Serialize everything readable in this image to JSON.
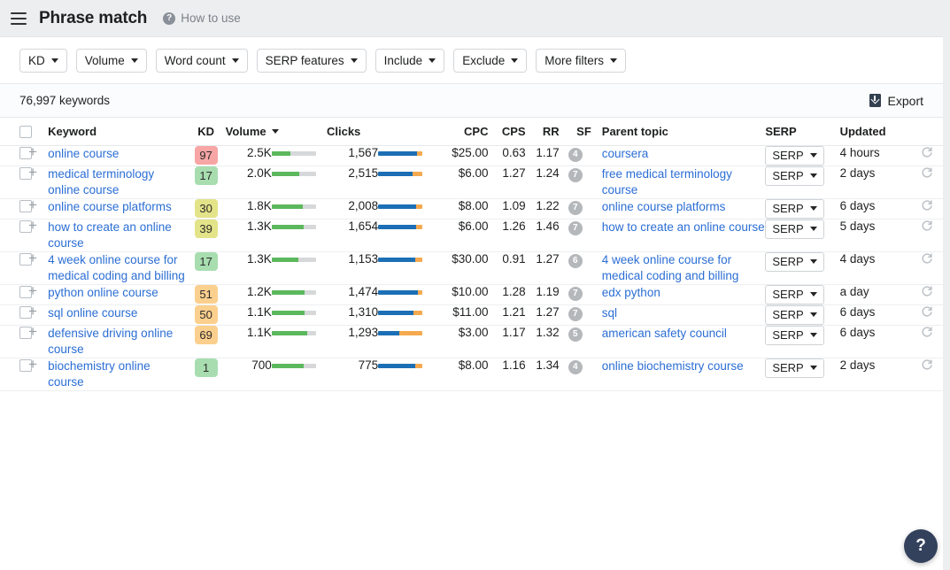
{
  "header": {
    "title": "Phrase match",
    "how_to_use": "How to use",
    "menu_icon": "hamburger-icon",
    "help_icon": "question-circle-icon"
  },
  "filters": [
    {
      "label": "KD"
    },
    {
      "label": "Volume"
    },
    {
      "label": "Word count"
    },
    {
      "label": "SERP features"
    },
    {
      "label": "Include"
    },
    {
      "label": "Exclude"
    },
    {
      "label": "More filters"
    }
  ],
  "summary": {
    "keyword_count": "76,997 keywords",
    "export_label": "Export",
    "export_icon": "download-icon"
  },
  "table": {
    "columns": [
      {
        "key": "checkbox",
        "label": ""
      },
      {
        "key": "add",
        "label": ""
      },
      {
        "key": "keyword",
        "label": "Keyword"
      },
      {
        "key": "kd",
        "label": "KD"
      },
      {
        "key": "volume",
        "label": "Volume",
        "sorted": true
      },
      {
        "key": "volume_bar",
        "label": ""
      },
      {
        "key": "clicks",
        "label": "Clicks"
      },
      {
        "key": "clicks_bar",
        "label": ""
      },
      {
        "key": "cpc",
        "label": "CPC"
      },
      {
        "key": "cps",
        "label": "CPS"
      },
      {
        "key": "rr",
        "label": "RR"
      },
      {
        "key": "sf",
        "label": "SF"
      },
      {
        "key": "parent_topic",
        "label": "Parent topic"
      },
      {
        "key": "serp",
        "label": "SERP"
      },
      {
        "key": "updated",
        "label": "Updated"
      }
    ],
    "serp_button_label": "SERP",
    "rows": [
      {
        "keyword": "online course",
        "kd": "97",
        "kd_color": "#f7a5a5",
        "volume": "2.5K",
        "volume_pct": 42,
        "clicks": "1,567",
        "clicks_blue_pct": 88,
        "clicks_orange_pct": 12,
        "cpc": "$25.00",
        "cps": "0.63",
        "rr": "1.17",
        "sf": "4",
        "parent_topic": "coursera",
        "serp": "SERP",
        "updated": "4 hours"
      },
      {
        "keyword": "medical terminology online course",
        "kd": "17",
        "kd_color": "#a8ddb0",
        "volume": "2.0K",
        "volume_pct": 62,
        "clicks": "2,515",
        "clicks_blue_pct": 78,
        "clicks_orange_pct": 22,
        "cpc": "$6.00",
        "cps": "1.27",
        "rr": "1.24",
        "sf": "7",
        "parent_topic": "free medical terminology course",
        "serp": "SERP",
        "updated": "2 days"
      },
      {
        "keyword": "online course platforms",
        "kd": "30",
        "kd_color": "#e3e389",
        "volume": "1.8K",
        "volume_pct": 70,
        "clicks": "2,008",
        "clicks_blue_pct": 86,
        "clicks_orange_pct": 14,
        "cpc": "$8.00",
        "cps": "1.09",
        "rr": "1.22",
        "sf": "7",
        "parent_topic": "online course platforms",
        "serp": "SERP",
        "updated": "6 days"
      },
      {
        "keyword": "how to create an online course",
        "kd": "39",
        "kd_color": "#e3e389",
        "volume": "1.3K",
        "volume_pct": 72,
        "clicks": "1,654",
        "clicks_blue_pct": 86,
        "clicks_orange_pct": 14,
        "cpc": "$6.00",
        "cps": "1.26",
        "rr": "1.46",
        "sf": "7",
        "parent_topic": "how to create an online course",
        "serp": "SERP",
        "updated": "5 days"
      },
      {
        "keyword": "4 week online course for medical coding and billing",
        "kd": "17",
        "kd_color": "#a8ddb0",
        "volume": "1.3K",
        "volume_pct": 60,
        "clicks": "1,153",
        "clicks_blue_pct": 84,
        "clicks_orange_pct": 16,
        "cpc": "$30.00",
        "cps": "0.91",
        "rr": "1.27",
        "sf": "6",
        "parent_topic": "4 week online course for medical coding and billing",
        "serp": "SERP",
        "updated": "4 days"
      },
      {
        "keyword": "python online course",
        "kd": "51",
        "kd_color": "#fbcf8d",
        "volume": "1.2K",
        "volume_pct": 74,
        "clicks": "1,474",
        "clicks_blue_pct": 90,
        "clicks_orange_pct": 10,
        "cpc": "$10.00",
        "cps": "1.28",
        "rr": "1.19",
        "sf": "7",
        "parent_topic": "edx python",
        "serp": "SERP",
        "updated": "a day"
      },
      {
        "keyword": "sql online course",
        "kd": "50",
        "kd_color": "#fbcf8d",
        "volume": "1.1K",
        "volume_pct": 74,
        "clicks": "1,310",
        "clicks_blue_pct": 80,
        "clicks_orange_pct": 20,
        "cpc": "$11.00",
        "cps": "1.21",
        "rr": "1.27",
        "sf": "7",
        "parent_topic": "sql",
        "serp": "SERP",
        "updated": "6 days"
      },
      {
        "keyword": "defensive driving online course",
        "kd": "69",
        "kd_color": "#fbcf8d",
        "volume": "1.1K",
        "volume_pct": 80,
        "clicks": "1,293",
        "clicks_blue_pct": 48,
        "clicks_orange_pct": 52,
        "cpc": "$3.00",
        "cps": "1.17",
        "rr": "1.32",
        "sf": "5",
        "parent_topic": "american safety council",
        "serp": "SERP",
        "updated": "6 days"
      },
      {
        "keyword": "biochemistry online course",
        "kd": "1",
        "kd_color": "#a8ddb0",
        "volume": "700",
        "volume_pct": 72,
        "clicks": "775",
        "clicks_blue_pct": 84,
        "clicks_orange_pct": 16,
        "cpc": "$8.00",
        "cps": "1.16",
        "rr": "1.34",
        "sf": "4",
        "parent_topic": "online biochemistry course",
        "serp": "SERP",
        "updated": "2 days"
      }
    ]
  },
  "help_fab": {
    "label": "?"
  },
  "colors": {
    "link": "#2b6ed4",
    "bar_green": "#5cb85c",
    "bar_blue": "#1c6fb5",
    "bar_orange": "#f5a94e",
    "fab": "#33415c"
  }
}
